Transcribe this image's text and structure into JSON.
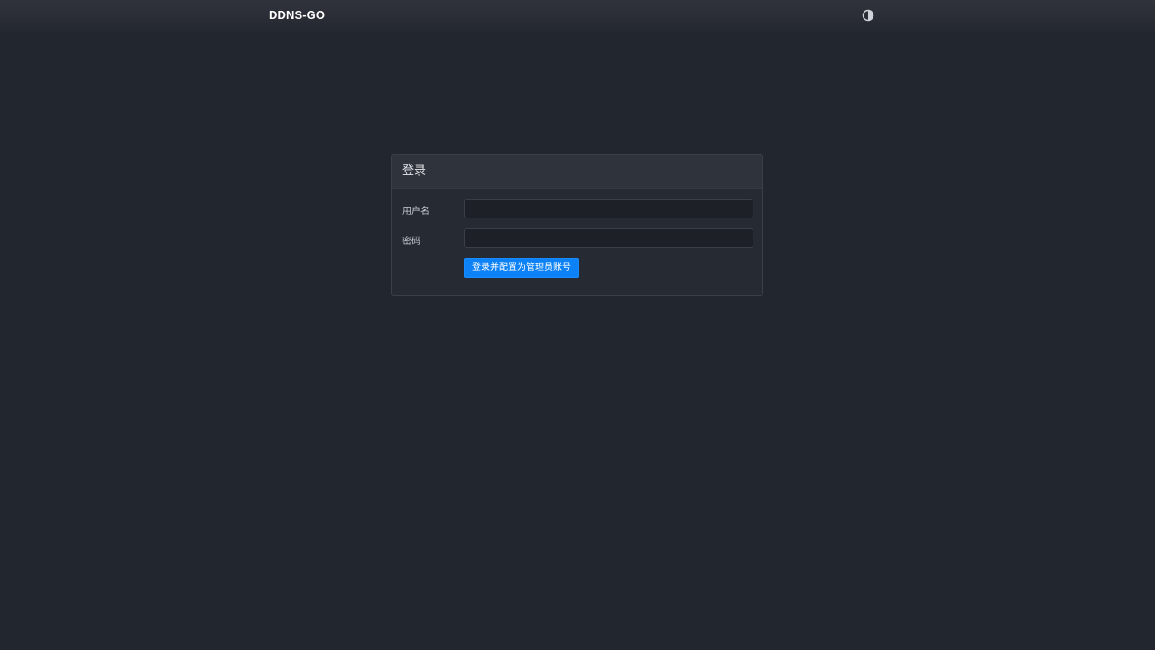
{
  "navbar": {
    "brand": "DDNS-GO",
    "theme_toggle_icon": "half-circle-theme-icon"
  },
  "login": {
    "title": "登录",
    "username_label": "用户名",
    "username_value": "",
    "password_label": "密码",
    "password_value": "",
    "submit_label": "登录并配置为管理员账号"
  },
  "colors": {
    "background": "#22262e",
    "navbar": "#2a2d35",
    "card": "#262a32",
    "card_header": "#2f333c",
    "input": "#1d2027",
    "primary_button": "#0d82f7"
  }
}
